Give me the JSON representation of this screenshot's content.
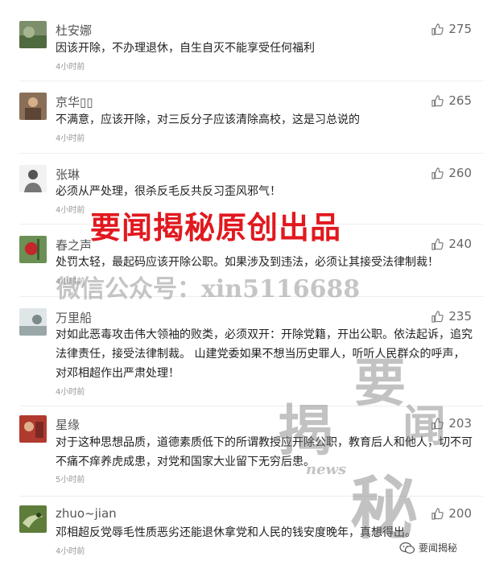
{
  "comments": [
    {
      "author": "杜安娜",
      "likes": "275",
      "text": "因该开除，不办理退休，自生自灭不能享受任何福利",
      "time": "4小时前"
    },
    {
      "author": "京华▯▯",
      "likes": "265",
      "text": "不满意，应该开除，对三反分子应该清除高校，这是习总说的",
      "time": "4小时前"
    },
    {
      "author": "张琳",
      "likes": "260",
      "text": "必须从严处理，很杀反毛反共反习歪风邪气！",
      "time": "4小时前"
    },
    {
      "author": "春之声",
      "likes": "240",
      "text": "处罚太轻，最起码应该开除公职。如果涉及到违法，必须让其接受法律制裁！",
      "time": "4小时前"
    },
    {
      "author": "万里船",
      "likes": "235",
      "text": "对如此恶毒攻击伟大领袖的败类，必须双开：开除党籍，开出公职。依法起诉，追究法律责任，接受法律制裁。 山建党委如果不想当历史罪人，听听人民群众的呼声，对邓相超作出严肃处理！",
      "time": "4小时前"
    },
    {
      "author": "星缘",
      "likes": "203",
      "text": "对于这种思想品质，道德素质低下的所谓教授应开除公职，教育后人和他人，切不可不痛不痒养虎成患，对党和国家大业留下无穷后患。",
      "time": "5小时前"
    },
    {
      "author": "zhuo~jian",
      "likes": "200",
      "text": "邓相超反党辱毛性质恶劣还能退休拿党和人民的钱安度晚年，真想得出。",
      "time": "4小时前"
    }
  ],
  "watermark": {
    "title": "要闻揭秘原创出品",
    "subtitle": "微信公众号：xin5116688",
    "stamp_chars": [
      "要",
      "揭",
      "闻",
      "秘"
    ],
    "stamp_small": "news"
  },
  "brand": {
    "label": "要闻揭秘",
    "icon": "wechat-icon"
  },
  "colors": {
    "title_red": "#e1191f",
    "text": "#222222",
    "meta": "#999999"
  }
}
